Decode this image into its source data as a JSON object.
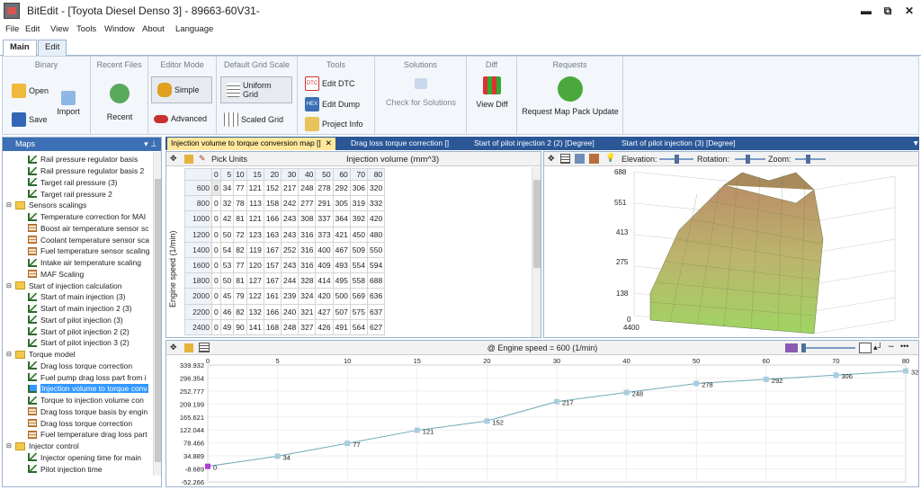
{
  "window": {
    "title": "BitEdit - [Toyota Diesel Denso 3] - 89663-60V31-",
    "minimize": "▬",
    "restore": "⧉",
    "close": "✕"
  },
  "menu": [
    "File",
    "Edit",
    "View",
    "Tools",
    "Window",
    "About",
    "Language"
  ],
  "ribbon_tabs": [
    "Main",
    "Edit"
  ],
  "ribbon": {
    "binary": {
      "title": "Binary",
      "open": "Open",
      "save": "Save",
      "import": "Import"
    },
    "recent": {
      "title": "Recent Files",
      "recent": "Recent"
    },
    "editor": {
      "title": "Editor Mode",
      "simple": "Simple",
      "advanced": "Advanced"
    },
    "grid_scale": {
      "title": "Default Grid Scale",
      "uniform": "Uniform Grid",
      "scaled": "Scaled Grid"
    },
    "tools": {
      "title": "Tools",
      "dtc": "Edit DTC",
      "dump": "Edit Dump",
      "project": "Project Info",
      "dtc_icon_text": "DTC",
      "hex_icon_text": "HEX"
    },
    "solutions": {
      "title": "Solutions",
      "check": "Check for Solutions"
    },
    "diff": {
      "title": "Diff",
      "view": "View Diff"
    },
    "requests": {
      "title": "Requests",
      "update": "Request Map Pack Update"
    }
  },
  "maps_panel": {
    "title": "Maps",
    "items": [
      {
        "label": "Rail pressure regulator basis",
        "type": "line",
        "indent": 2
      },
      {
        "label": "Rail pressure regulator basis 2",
        "type": "line",
        "indent": 2
      },
      {
        "label": "Target rail pressure (3)",
        "type": "line",
        "indent": 2
      },
      {
        "label": "Target rail pressure 2",
        "type": "line",
        "indent": 2
      },
      {
        "label": "Sensors scalings",
        "type": "folder",
        "indent": 0
      },
      {
        "label": "Temperature correction for MAI",
        "type": "line",
        "indent": 2
      },
      {
        "label": "Boost air temperature sensor sc",
        "type": "grid",
        "indent": 2
      },
      {
        "label": "Coolant temperature sensor sca",
        "type": "grid",
        "indent": 2
      },
      {
        "label": "Fuel temperature sensor scaling",
        "type": "grid",
        "indent": 2
      },
      {
        "label": "Intake air temperature scaling",
        "type": "line",
        "indent": 2
      },
      {
        "label": "MAF Scaling",
        "type": "grid",
        "indent": 2
      },
      {
        "label": "Start of injection calculation",
        "type": "folder",
        "indent": 0
      },
      {
        "label": "Start of main injection (3)",
        "type": "line",
        "indent": 2
      },
      {
        "label": "Start of main injection 2 (3)",
        "type": "line",
        "indent": 2
      },
      {
        "label": "Start of pilot injection (3)",
        "type": "line",
        "indent": 2
      },
      {
        "label": "Start of pilot injection 2 (2)",
        "type": "line",
        "indent": 2
      },
      {
        "label": "Start of pilot injection 3 (2)",
        "type": "line",
        "indent": 2
      },
      {
        "label": "Torque model",
        "type": "folder",
        "indent": 0
      },
      {
        "label": "Drag loss torque correction",
        "type": "line",
        "indent": 2
      },
      {
        "label": "Fuel pump drag loss part from i",
        "type": "line",
        "indent": 2
      },
      {
        "label": "Injection volume to torque conv",
        "type": "line",
        "indent": 2,
        "selected": true
      },
      {
        "label": "Torque to injection volume con",
        "type": "line",
        "indent": 2
      },
      {
        "label": "Drag loss torque basis by engin",
        "type": "grid",
        "indent": 2
      },
      {
        "label": "Drag loss torque correction",
        "type": "grid",
        "indent": 2
      },
      {
        "label": "Fuel temperature drag loss part",
        "type": "grid",
        "indent": 2
      },
      {
        "label": "Injector control",
        "type": "folder",
        "indent": 0
      },
      {
        "label": "Injector opening time for main",
        "type": "line",
        "indent": 2
      },
      {
        "label": "Pilot injection time",
        "type": "line",
        "indent": 2
      }
    ]
  },
  "doc_tabs": [
    {
      "label": "Injection volume to torque conversion map []",
      "active": true
    },
    {
      "label": "Drag loss torque correction []",
      "active": false
    },
    {
      "label": "Start of pilot injection 2 (2) [Degree]",
      "active": false
    },
    {
      "label": "Start of pilot injection (3) [Degree]",
      "active": false
    }
  ],
  "grid": {
    "pick_units": "Pick Units",
    "x_label": "Injection volume (mm^3)",
    "y_label": "Engine speed (1/min)",
    "cols": [
      "0",
      "5",
      "10",
      "15",
      "20",
      "30",
      "40",
      "50",
      "60",
      "70",
      "80"
    ],
    "rows": [
      {
        "h": "600",
        "v": [
          "0",
          "34",
          "77",
          "121",
          "152",
          "217",
          "248",
          "278",
          "292",
          "306",
          "320"
        ]
      },
      {
        "h": "800",
        "v": [
          "0",
          "32",
          "78",
          "113",
          "158",
          "242",
          "277",
          "291",
          "305",
          "319",
          "332"
        ]
      },
      {
        "h": "1000",
        "v": [
          "0",
          "42",
          "81",
          "121",
          "166",
          "243",
          "308",
          "337",
          "364",
          "392",
          "420"
        ]
      },
      {
        "h": "1200",
        "v": [
          "0",
          "50",
          "72",
          "123",
          "163",
          "243",
          "316",
          "373",
          "421",
          "450",
          "480"
        ]
      },
      {
        "h": "1400",
        "v": [
          "0",
          "54",
          "82",
          "119",
          "167",
          "252",
          "316",
          "400",
          "467",
          "509",
          "550"
        ]
      },
      {
        "h": "1600",
        "v": [
          "0",
          "53",
          "77",
          "120",
          "157",
          "243",
          "316",
          "409",
          "493",
          "554",
          "594"
        ]
      },
      {
        "h": "1800",
        "v": [
          "0",
          "50",
          "81",
          "127",
          "167",
          "244",
          "328",
          "414",
          "495",
          "558",
          "688"
        ]
      },
      {
        "h": "2000",
        "v": [
          "0",
          "45",
          "79",
          "122",
          "161",
          "239",
          "324",
          "420",
          "500",
          "569",
          "636"
        ]
      },
      {
        "h": "2200",
        "v": [
          "0",
          "46",
          "82",
          "132",
          "166",
          "240",
          "321",
          "427",
          "507",
          "575",
          "637"
        ]
      },
      {
        "h": "2400",
        "v": [
          "0",
          "49",
          "90",
          "141",
          "168",
          "248",
          "327",
          "426",
          "491",
          "564",
          "627"
        ]
      }
    ]
  },
  "surface": {
    "elevation": "Elevation:",
    "rotation": "Rotation:",
    "zoom": "Zoom:",
    "z_ticks": [
      "688",
      "551",
      "413",
      "275",
      "138",
      "0"
    ],
    "x_tick": "4400"
  },
  "chart_data": {
    "type": "line",
    "title": "@ Engine speed = 600 (1/min)",
    "x": [
      0,
      5,
      10,
      15,
      20,
      30,
      40,
      50,
      60,
      70,
      80
    ],
    "y": [
      0,
      34,
      77,
      121,
      152,
      217,
      248,
      278,
      292,
      306,
      320
    ],
    "x_ticks": [
      "0",
      "5",
      "10",
      "15",
      "20",
      "30",
      "40",
      "50",
      "60",
      "70",
      "80"
    ],
    "y_ticks": [
      "339.932",
      "296.354",
      "252.777",
      "209.199",
      "165.621",
      "122.044",
      "78.466",
      "34.889",
      "-8.689",
      "-52.266"
    ],
    "ylim": [
      -52.266,
      339.932
    ],
    "colors": {
      "line": "#6fa8b5",
      "marker": "#a9cde0",
      "first_marker": "#b43cd6"
    }
  }
}
